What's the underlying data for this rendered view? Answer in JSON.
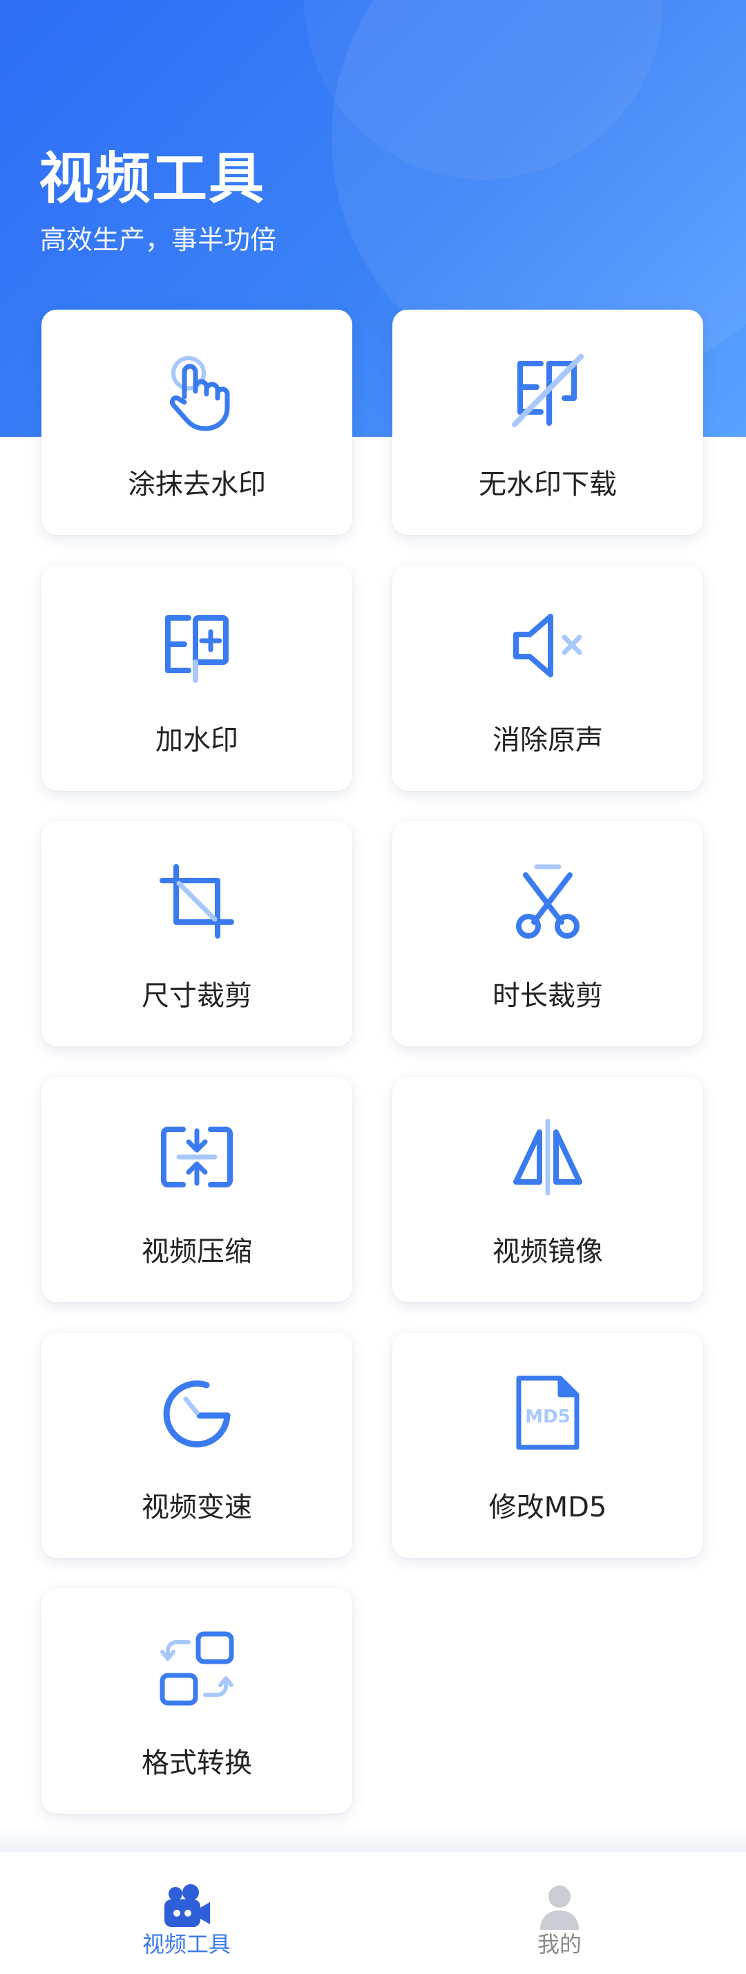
{
  "header": {
    "title": "视频工具",
    "subtitle": "高效生产，事半功倍"
  },
  "tools": [
    {
      "label": "涂抹去水印",
      "icon": "hand-tap-icon"
    },
    {
      "label": "无水印下载",
      "icon": "watermark-off-icon"
    },
    {
      "label": "加水印",
      "icon": "watermark-add-icon"
    },
    {
      "label": "消除原声",
      "icon": "mute-icon"
    },
    {
      "label": "尺寸裁剪",
      "icon": "crop-icon"
    },
    {
      "label": "时长裁剪",
      "icon": "scissors-icon"
    },
    {
      "label": "视频压缩",
      "icon": "compress-icon"
    },
    {
      "label": "视频镜像",
      "icon": "mirror-icon"
    },
    {
      "label": "视频变速",
      "icon": "speed-icon"
    },
    {
      "label": "修改MD5",
      "icon": "md5-file-icon"
    },
    {
      "label": "格式转换",
      "icon": "convert-icon"
    }
  ],
  "icon_text": {
    "md5": "MD5",
    "stamp": "印"
  },
  "tabbar": {
    "video_tools_label": "视频工具",
    "mine_label": "我的",
    "active_color": "#3a78f2",
    "inactive_color": "#8a8a8a"
  },
  "colors": {
    "accent": "#3b7bf0",
    "accent_light": "#a8c8fb"
  }
}
